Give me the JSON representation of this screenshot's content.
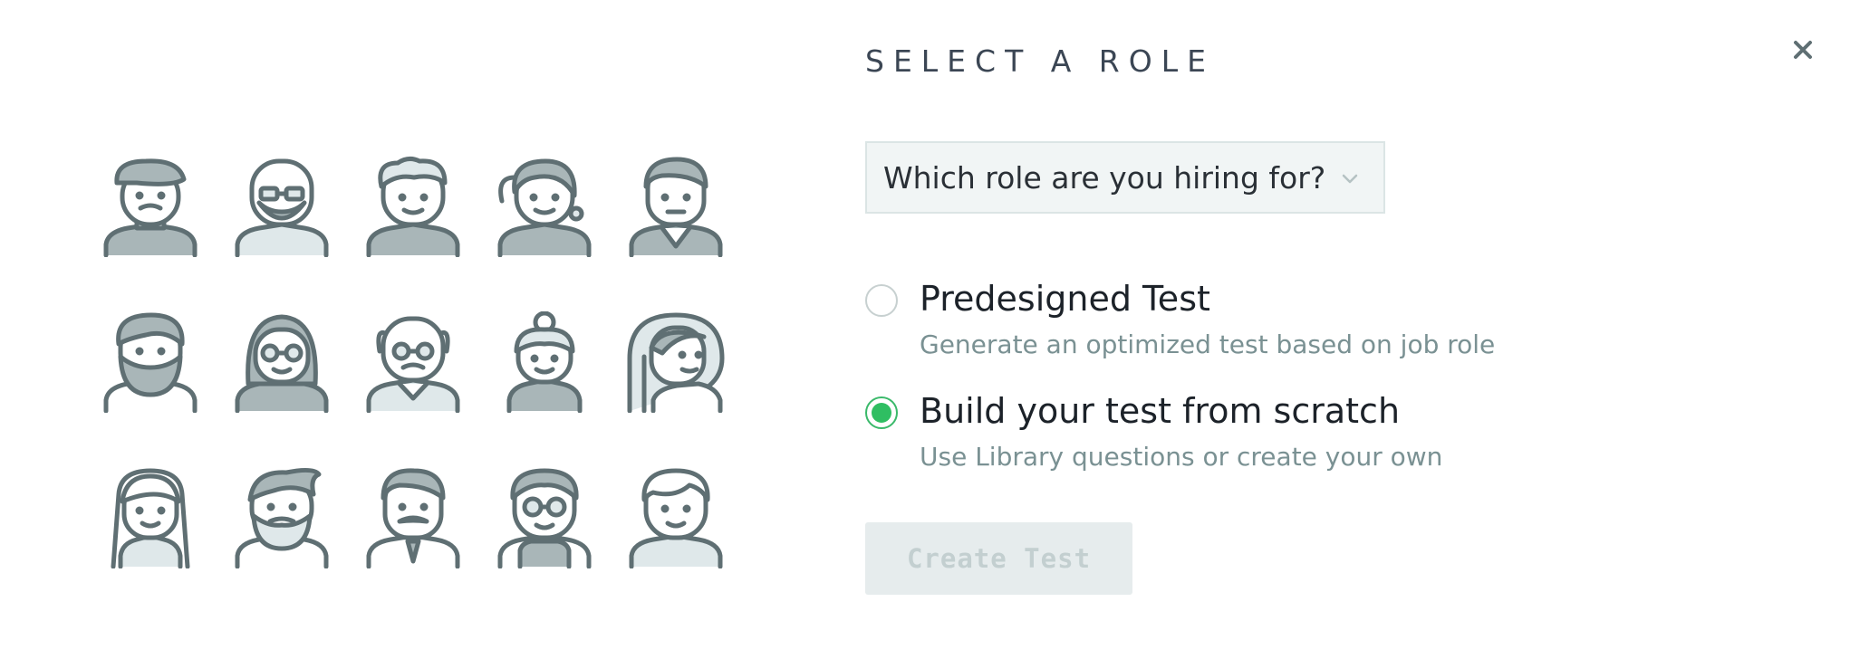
{
  "modal": {
    "title": "SELECT A ROLE",
    "close_icon": "close-icon"
  },
  "role_select": {
    "placeholder": "Which role are you hiring for?",
    "icon": "chevron-down-icon"
  },
  "options": [
    {
      "title": "Predesigned Test",
      "description": "Generate an optimized test based on job role",
      "selected": false
    },
    {
      "title": "Build your test from scratch",
      "description": "Use Library questions or create your own",
      "selected": true
    }
  ],
  "create_button": {
    "label": "Create Test",
    "disabled": true
  },
  "avatars": [
    "man-beret-mustache-avatar",
    "bald-man-glasses-beard-avatar",
    "curly-hair-man-avatar",
    "woman-side-ponytail-avatar",
    "man-suit-avatar",
    "man-full-beard-avatar",
    "woman-glasses-avatar",
    "bald-man-glasses-avatar",
    "woman-bun-avatar",
    "woman-long-hair-avatar",
    "woman-straight-hair-avatar",
    "man-quiff-beard-avatar",
    "man-mustache-tie-avatar",
    "man-glasses-avatar",
    "young-man-avatar"
  ],
  "colors": {
    "accent": "#2fbe62",
    "icon_stroke": "#5f6f73",
    "icon_fill": "#a9b6b8",
    "icon_light": "#dfe8ea",
    "muted_text": "#7a9193"
  }
}
